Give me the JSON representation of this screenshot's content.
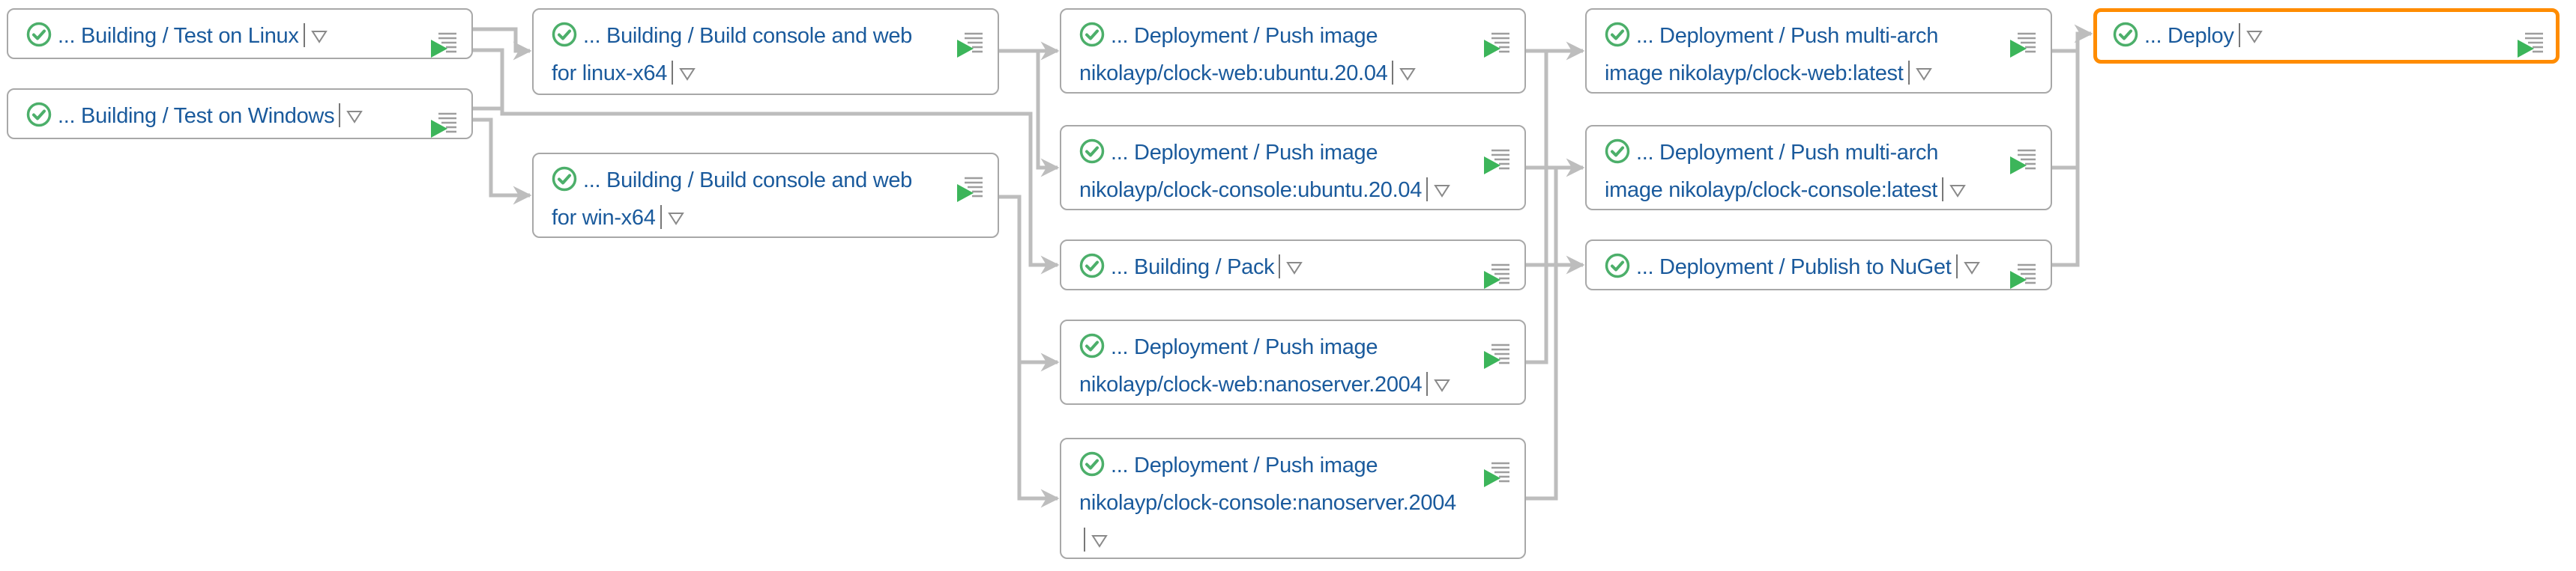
{
  "pipeline": {
    "accent_selected": "#ff8c00",
    "status_color": "#4caf6a",
    "link_color": "#1a5a9c",
    "nodes": [
      {
        "id": "test-linux",
        "prefix": "...",
        "label": "Building / Test on Linux",
        "status": "success",
        "status_icon": "check-circle-icon",
        "selected": false
      },
      {
        "id": "test-windows",
        "prefix": "...",
        "label": "Building / Test on Windows",
        "status": "success",
        "status_icon": "check-circle-icon",
        "selected": false
      },
      {
        "id": "build-linux",
        "prefix": "...",
        "label": "Building / Build console and web for linux-x64",
        "status": "success",
        "status_icon": "check-circle-icon",
        "selected": false
      },
      {
        "id": "build-win",
        "prefix": "...",
        "label": "Building / Build console and web for win-x64",
        "status": "success",
        "status_icon": "check-circle-icon",
        "selected": false
      },
      {
        "id": "push-web-ubuntu",
        "prefix": "...",
        "label": "Deployment / Push image nikolayp/clock-web:ubuntu.20.04",
        "status": "success",
        "status_icon": "check-circle-icon",
        "selected": false
      },
      {
        "id": "push-console-ubuntu",
        "prefix": "...",
        "label": "Deployment / Push image nikolayp/clock-console:ubuntu.20.04",
        "status": "success",
        "status_icon": "check-circle-icon",
        "selected": false
      },
      {
        "id": "pack",
        "prefix": "...",
        "label": "Building / Pack",
        "status": "success",
        "status_icon": "check-circle-icon",
        "selected": false
      },
      {
        "id": "push-web-nano",
        "prefix": "...",
        "label": "Deployment / Push image nikolayp/clock-web:nanoserver.2004",
        "status": "success",
        "status_icon": "check-circle-icon",
        "selected": false
      },
      {
        "id": "push-console-nano",
        "prefix": "...",
        "label": "Deployment / Push image nikolayp/clock-console:nanoserver.2004",
        "status": "success",
        "status_icon": "check-circle-icon",
        "selected": false
      },
      {
        "id": "multiarch-web",
        "prefix": "...",
        "label": "Deployment / Push multi-arch image nikolayp/clock-web:latest",
        "status": "success",
        "status_icon": "check-circle-icon",
        "selected": false
      },
      {
        "id": "multiarch-console",
        "prefix": "...",
        "label": "Deployment / Push multi-arch image nikolayp/clock-console:latest",
        "status": "success",
        "status_icon": "check-circle-icon",
        "selected": false
      },
      {
        "id": "publish-nuget",
        "prefix": "...",
        "label": "Deployment / Publish to NuGet",
        "status": "success",
        "status_icon": "check-circle-icon",
        "selected": false
      },
      {
        "id": "deploy",
        "prefix": "...",
        "label": "Deploy",
        "status": "success",
        "status_icon": "check-circle-icon",
        "selected": true
      }
    ],
    "edges": [
      [
        "test-linux",
        "build-linux"
      ],
      [
        "test-linux",
        "pack"
      ],
      [
        "test-windows",
        "pack"
      ],
      [
        "test-windows",
        "build-win"
      ],
      [
        "build-linux",
        "push-web-ubuntu"
      ],
      [
        "build-linux",
        "push-console-ubuntu"
      ],
      [
        "build-win",
        "push-web-nano"
      ],
      [
        "build-win",
        "push-console-nano"
      ],
      [
        "push-web-ubuntu",
        "multiarch-web"
      ],
      [
        "push-web-nano",
        "multiarch-web"
      ],
      [
        "push-console-ubuntu",
        "multiarch-console"
      ],
      [
        "push-console-nano",
        "multiarch-console"
      ],
      [
        "pack",
        "publish-nuget"
      ],
      [
        "multiarch-web",
        "deploy"
      ],
      [
        "multiarch-console",
        "deploy"
      ],
      [
        "publish-nuget",
        "deploy"
      ]
    ],
    "dropdown_icon": "triangle-down-icon",
    "log_icon": "build-log-icon"
  }
}
